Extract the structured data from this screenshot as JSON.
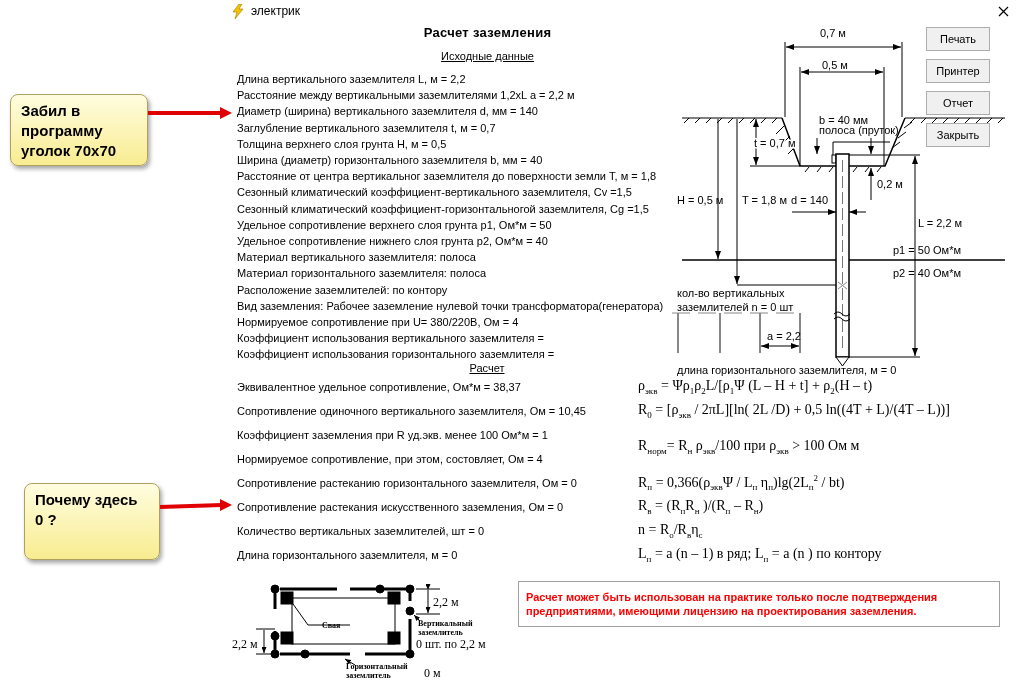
{
  "window": {
    "title": "электрик"
  },
  "heading": "Расчет заземления",
  "inputs": {
    "title": "Исходные данные",
    "lines": [
      "Длина вертикального заземлителя L, м = 2,2",
      "Расстояние между вертикальными заземлителями 1,2xL a = 2,2 м",
      "Диаметр (ширина) вертикального заземлителя d, мм = 140",
      "Заглубление вертикального заземлителя t, м = 0,7",
      "Толщина верхнего слоя грунта H, м = 0,5",
      "Ширина (диаметр) горизонтального заземлителя b, мм = 40",
      "Расстояние от центра вертикальног заземлителя до поверхности земли T, м = 1,8",
      "Сезонный климатический коэффициент-вертикального заземлителя, Cv =1,5",
      "Сезонный климатический коэффициент-горизонтальногой заземлителя, Cg =1,5",
      "Удельное сопротивление верхнего слоя грунта  p1, Ом*м = 50",
      "Удельное сопротивление нижнего слоя грунта  p2, Ом*м = 40",
      "Материал вертикального заземлителя: полоса",
      "Материал горизонтального заземлителя: полоса",
      "Расположение заземлителей: по контору",
      "Вид заземления: Рабочее заземление нулевой точки трансформатора(генератора)",
      "Нормируемое сопротивление при U= 380/220В, Ом = 4",
      "Коэффициент использования вертикального заземлителя =",
      "Коэффициент использования горизонтального заземлителя ="
    ]
  },
  "results": {
    "title": "Расчет",
    "rows": [
      {
        "label": "Эквивалентное удельное сопротивление, Ом*м = 38,37",
        "formula": "ρ$_{экв}$ = Ψρ$_{1}$ρ$_{2}$L/[ρ$_{1}$Ψ (L – H + t] + ρ$_{2}$(H – t)"
      },
      {
        "label": "Сопротивление одиночного вертикального заземлителя, Ом = 10,45",
        "formula": "R$_{0}$ = [ρ$_{экв}$ / 2πL][ln( 2L /D) + 0,5 ln((4T + L)/(4T – L))]"
      },
      {
        "label": "Коэффициент заземления при R уд.экв. менее 100 Ом*м = 1",
        "formula": "R$_{норм}$= R$_{н}$ ρ$_{экв}$/100 при  ρ$_{экв}$ > 100 Ом м"
      },
      {
        "label": "Нормируемое сопротивление, при этом, состовляет, Ом = 4"
      },
      {
        "label": "Сопротивление растеканию горизонтального заземлителя, Ом = 0",
        "formula": "R$_{п}$ = 0,366(ρ$_{экв}$Ψ / L$_{п}$ η$_{п}$)lg(2L$_{п}$$^{2}$ / bt)"
      },
      {
        "label": "Сопротивление растекания  искусственного заземления, Ом = 0",
        "formula": "R$_{в}$ = (R$_{п}$R$_{н}$ )/(R$_{п}$ – R$_{н}$)"
      },
      {
        "label": "Количество вертикальных заземлителей, шт = 0",
        "formula": "n = R$_{о}$/R$_{в}$η$_{с}$"
      },
      {
        "label": "Длина горизонтального заземлителя, м = 0",
        "formula": "L$_{п}$ = a (n – 1)  в ряд;  L$_{п}$ = a (n ) по контору"
      }
    ]
  },
  "diagram": {
    "outer_width": "0,7 м",
    "inner_width": "0,5 м",
    "strip_width": "b = 40 мм",
    "strip_type": "полоса (пруток)",
    "depth": "t = 0,7 м",
    "layer_thickness": "H = 0,5 м",
    "center_depth": "T = 1,8 м",
    "diameter": "d = 140",
    "offset": "0,2 м",
    "length": "L = 2,2 м",
    "rho1": "p1 = 50 Ом*м",
    "rho2": "p2 = 40 Ом*м",
    "count": [
      "кол-во вертикальных",
      "заземлителей n = 0 шт"
    ],
    "spacing": "a = 2,2",
    "horizontal_length": "длина горизонтального заземлителя, м = 0"
  },
  "buttons": [
    "Печать",
    "Принтер",
    "Отчет",
    "Закрыть"
  ],
  "scheme": {
    "vertical_spacing": "2,2 м",
    "pile": "Свая",
    "vertical_label": [
      "Вертикальный",
      "заземлитель"
    ],
    "horizontal_spacing": "2,2 м",
    "vertical_count": "0 шт. по 2,2  м",
    "horizontal_label": [
      "Горизонтальный",
      "заземлитель"
    ],
    "horizontal_length": "0 м"
  },
  "warning": "Расчет может быть использован на практике только после подтверждения предприятиями, имеющими лицензию на проектирования заземления.",
  "annotations": [
    {
      "lines": [
        "Забил в",
        "программу",
        "уголок 70x70"
      ]
    },
    {
      "lines": [
        "Почему здесь",
        "0 ?"
      ]
    }
  ]
}
